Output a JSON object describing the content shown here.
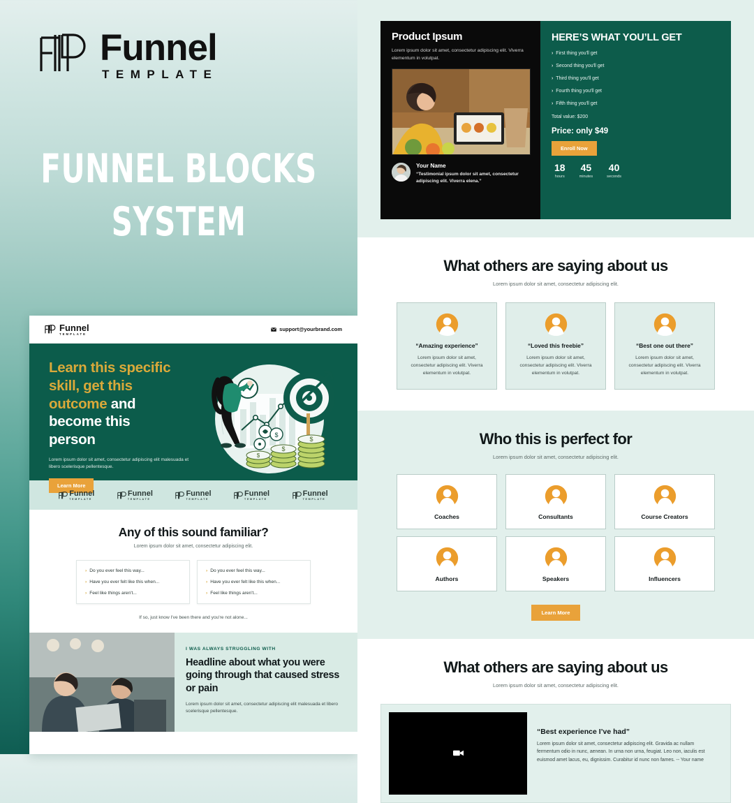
{
  "brand": {
    "name": "Funnel",
    "subtitle": "TEMPLATE",
    "logo_icon": "funnel-template-logo-icon"
  },
  "headline": "FUNNEL BLOCKS SYSTEM",
  "headline_line1": "FUNNEL BLOCKS",
  "headline_line2": "SYSTEM",
  "colors": {
    "deep_green": "#0c5c4b",
    "orange": "#e9a23a",
    "gold": "#d9a93a",
    "mint": "#e2f0ec",
    "card_mint": "#e0eeea",
    "black": "#0a0a0a"
  },
  "landing_mock": {
    "nav": {
      "logo_name": "Funnel",
      "logo_sub": "TEMPLATE",
      "email": "support@yourbrand.com",
      "email_icon": "envelope-icon"
    },
    "hero": {
      "h1_part1": "Learn this specific skill, get this outcome",
      "h1_part2": "and become this person",
      "line1_gold": "Learn this specific",
      "line2_gold": "skill, get this",
      "line3_gold": "outcome",
      "line3_white": " and",
      "line4_white": "become this",
      "line5_white": "person",
      "paragraph": "Lorem ipsum dolor sit amet, consectetur adipiscing elit malesuada et libero scelerisque pellentesque.",
      "cta": "Learn More",
      "illustration": "person-chart-target-coins-illustration"
    },
    "logo_strip": {
      "count": 5,
      "name": "Funnel",
      "sub": "TEMPLATE"
    },
    "familiar": {
      "heading": "Any of this sound familiar?",
      "sub": "Lorem ipsum dolor sit amet, consectetur adipiscing elit.",
      "items": [
        "Do you ever feel this way...",
        "Have you ever felt like this when...",
        "Feel like things aren't..."
      ],
      "footer": "If so, just know I've been there and you're not alone..."
    },
    "story": {
      "kicker": "I WAS ALWAYS STRUGGLING WITH",
      "heading": "Headline about what you were going through that caused stress or pain",
      "paragraph": "Lorem ipsum dolor sit amet, consectetur adipiscing elit malesuada et libero scelerisque pellentesque.",
      "image": "two-people-with-laptop-photo"
    }
  },
  "product": {
    "title": "Product Ipsum",
    "paragraph": "Lorem ipsum dolor sit amet, consectetur adipiscing elit. Viverra elementum in volutpat.",
    "image": "woman-with-tablet-groceries-photo",
    "testimonial": {
      "avatar": "person-avatar-photo",
      "name": "Your Name",
      "quote": "“Testimonial ipsum dolor sit amet, consectetur adipiscing elit. Viverra elena.”"
    },
    "offer": {
      "title": "HERE’S WHAT YOU’LL GET",
      "items": [
        "First thing you'll get",
        "Second thing you'll get",
        "Third thing you'll get",
        "Fourth thing you'll get",
        "Fifth thing you'll get"
      ],
      "total_value": "Total value: $200",
      "price": "Price: only $49",
      "cta": "Enroll Now",
      "timer": [
        {
          "num": "18",
          "label": "hours"
        },
        {
          "num": "45",
          "label": "minutes"
        },
        {
          "num": "40",
          "label": "seconds"
        }
      ]
    }
  },
  "testimonials_section": {
    "heading": "What others are saying about us",
    "sub": "Lorem ipsum dolor sit amet, consectetur adipiscing elit.",
    "cards": [
      {
        "quote": "“Amazing experience”",
        "text": "Lorem ipsum dolor sit amet, consectetur adipiscing elit. Viverra elementum in volutpat.",
        "icon": "avatar-icon"
      },
      {
        "quote": "“Loved this freebie”",
        "text": "Lorem ipsum dolor sit amet, consectetur adipiscing elit. Viverra elementum in volutpat.",
        "icon": "avatar-icon"
      },
      {
        "quote": "“Best one out there”",
        "text": "Lorem ipsum dolor sit amet, consectetur adipiscing elit. Viverra elementum in volutpat.",
        "icon": "avatar-icon"
      }
    ]
  },
  "perfect_for": {
    "heading": "Who this is perfect for",
    "sub": "Lorem ipsum dolor sit amet, consectetur adipiscing elit.",
    "cards": [
      {
        "label": "Coaches",
        "icon": "avatar-icon"
      },
      {
        "label": "Consultants",
        "icon": "avatar-icon"
      },
      {
        "label": "Course Creators",
        "icon": "avatar-icon"
      },
      {
        "label": "Authors",
        "icon": "avatar-icon"
      },
      {
        "label": "Speakers",
        "icon": "avatar-icon"
      },
      {
        "label": "Influencers",
        "icon": "avatar-icon"
      }
    ],
    "cta": "Learn More"
  },
  "video_testimonials": {
    "heading": "What others are saying about us",
    "sub": "Lorem ipsum dolor sit amet, consectetur adipiscing elit.",
    "video_icon": "video-camera-icon",
    "quote": "“Best experience I’ve had”",
    "text": "Lorem ipsum dolor sit amet, consectetur adipiscing elit. Gravida ac nullam fermentum odio in nunc, aenean. In urna non urna, feugiat. Leo non, iaculis est euismod amet lacus, eu, dignissim. Curabitur id nunc non fames. -- Your name"
  }
}
